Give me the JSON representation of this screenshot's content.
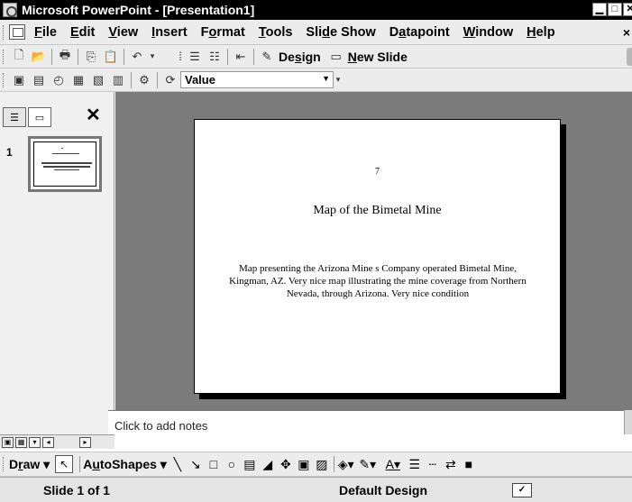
{
  "window": {
    "title": "Microsoft PowerPoint - [Presentation1]"
  },
  "menubar": {
    "items": [
      {
        "pre": "",
        "u": "F",
        "post": "ile"
      },
      {
        "pre": "",
        "u": "E",
        "post": "dit"
      },
      {
        "pre": "",
        "u": "V",
        "post": "iew"
      },
      {
        "pre": "",
        "u": "I",
        "post": "nsert"
      },
      {
        "pre": "F",
        "u": "o",
        "post": "rmat"
      },
      {
        "pre": "",
        "u": "T",
        "post": "ools"
      },
      {
        "pre": "Sli",
        "u": "d",
        "post": "e Show"
      },
      {
        "pre": "D",
        "u": "a",
        "post": "tapoint"
      },
      {
        "pre": "",
        "u": "W",
        "post": "indow"
      },
      {
        "pre": "",
        "u": "H",
        "post": "elp"
      }
    ],
    "close_glyph": "×"
  },
  "toolbar1": {
    "design_pre": "De",
    "design_u": "s",
    "design_post": "ign",
    "newslide_u": "N",
    "newslide_post": "ew Slide"
  },
  "toolbar2": {
    "dropdown_value": "Value"
  },
  "slide": {
    "number": "7",
    "title": "Map of the Bimetal Mine",
    "body": "Map presenting the Arizona Mine s Company operated Bimetal Mine, Kingman, AZ.  Very nice map illustrating the mine coverage from Northern Nevada, through Arizona. Very nice condition"
  },
  "thumbnail": {
    "number": "1"
  },
  "notes": {
    "placeholder": "Click to add notes"
  },
  "drawbar": {
    "draw_pre": "D",
    "draw_u": "r",
    "draw_post": "aw",
    "autoshapes_pre": "A",
    "autoshapes_u": "u",
    "autoshapes_post": "toShapes"
  },
  "statusbar": {
    "slide": "Slide 1 of 1",
    "design": "Default Design"
  }
}
